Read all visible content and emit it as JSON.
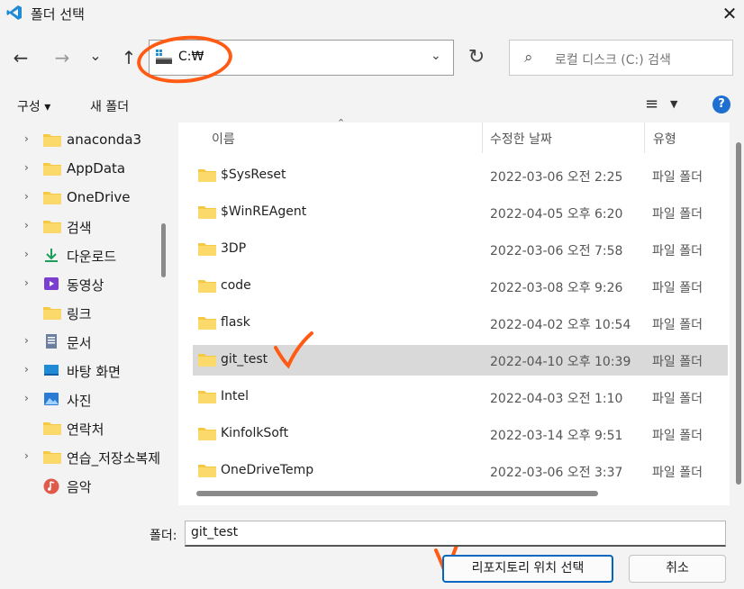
{
  "window": {
    "title": "폴더 선택",
    "close_symbol": "✕"
  },
  "nav": {
    "back": "←",
    "forward": "→",
    "history": "⌄",
    "up": "↑",
    "address": "C:₩",
    "address_chevron": "⌄",
    "refresh": "↻",
    "search_placeholder": "로컬 디스크 (C:) 검색"
  },
  "toolbar": {
    "organize": "구성 ▾",
    "new_folder": "새 폴더",
    "view": "≡",
    "view_chevron": "▼",
    "help": "?"
  },
  "sidebar": {
    "items": [
      {
        "label": "anaconda3",
        "chevron": "›",
        "icon": "folder-icon"
      },
      {
        "label": "AppData",
        "chevron": "›",
        "icon": "folder-icon"
      },
      {
        "label": "OneDrive",
        "chevron": "›",
        "icon": "folder-icon"
      },
      {
        "label": "검색",
        "chevron": "›",
        "icon": "folder-icon"
      },
      {
        "label": "다운로드",
        "chevron": "›",
        "icon": "download-icon"
      },
      {
        "label": "동영상",
        "chevron": "›",
        "icon": "video-icon"
      },
      {
        "label": "링크",
        "chevron": "",
        "icon": "folder-icon"
      },
      {
        "label": "문서",
        "chevron": "›",
        "icon": "document-icon"
      },
      {
        "label": "바탕 화면",
        "chevron": "›",
        "icon": "desktop-icon"
      },
      {
        "label": "사진",
        "chevron": "›",
        "icon": "picture-icon"
      },
      {
        "label": "연락처",
        "chevron": "",
        "icon": "folder-icon"
      },
      {
        "label": "연습_저장소복제",
        "chevron": "›",
        "icon": "folder-icon"
      },
      {
        "label": "음악",
        "chevron": "",
        "icon": "music-icon"
      }
    ]
  },
  "file_list": {
    "columns": {
      "name": "이름",
      "date": "수정한 날짜",
      "type": "유형"
    },
    "sort_indicator": "⌃",
    "rows": [
      {
        "name": "$SysReset",
        "date": "2022-03-06 오전 2:25",
        "type": "파일 폴더"
      },
      {
        "name": "$WinREAgent",
        "date": "2022-04-05 오후 6:20",
        "type": "파일 폴더"
      },
      {
        "name": "3DP",
        "date": "2022-03-06 오전 7:58",
        "type": "파일 폴더"
      },
      {
        "name": "code",
        "date": "2022-03-08 오후 9:26",
        "type": "파일 폴더"
      },
      {
        "name": "flask",
        "date": "2022-04-02 오후 10:54",
        "type": "파일 폴더"
      },
      {
        "name": "git_test",
        "date": "2022-04-10 오후 10:39",
        "type": "파일 폴더",
        "selected": true
      },
      {
        "name": "Intel",
        "date": "2022-04-03 오전 1:10",
        "type": "파일 폴더"
      },
      {
        "name": "KinfolkSoft",
        "date": "2022-03-14 오후 9:51",
        "type": "파일 폴더"
      },
      {
        "name": "OneDriveTemp",
        "date": "2022-03-06 오전 3:37",
        "type": "파일 폴더"
      }
    ]
  },
  "footer": {
    "folder_label": "폴더:",
    "folder_value": "git_test",
    "select_button": "리포지토리 위치 선택",
    "cancel_button": "취소"
  },
  "colors": {
    "accent": "#0067c0",
    "annotation": "#ff5b14",
    "folder": "#f6c945"
  }
}
